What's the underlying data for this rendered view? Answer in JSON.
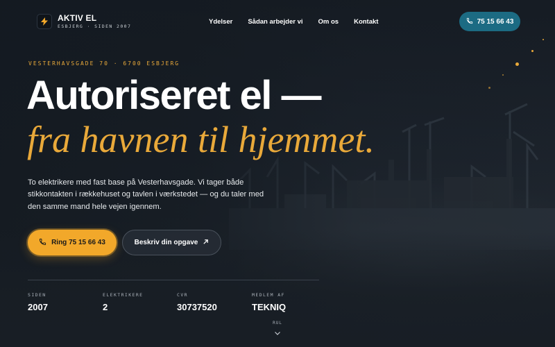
{
  "brand": {
    "name": "AKTIV EL",
    "subtitle": "ESBJERG · SIDEN 2007",
    "logo_icon": "lightning-bolt-icon"
  },
  "nav": {
    "links": [
      {
        "label": "Ydelser"
      },
      {
        "label": "Sådan arbejder vi"
      },
      {
        "label": "Om os"
      },
      {
        "label": "Kontakt"
      }
    ],
    "phone_label": "75 15 66 43",
    "phone_icon": "phone-icon"
  },
  "hero": {
    "address": "VESTERHAVSGADE 70 · 6700 ESBJERG",
    "headline": "Autoriseret el —",
    "headline_italic": "fra havnen til hjemmet.",
    "intro": "To elektrikere med fast base på Vesterhavsgade. Vi tager både stikkontakten i rækkehuset og tavlen i værkstedet — og du taler med den samme mand hele vejen igennem.",
    "primary_button": "Ring 75 15 66 43",
    "secondary_button": "Beskriv din opgave",
    "primary_icon": "phone-icon",
    "secondary_icon": "arrow-up-right-icon"
  },
  "stats": [
    {
      "label": "SIDEN",
      "value": "2007"
    },
    {
      "label": "ELEKTRIKERE",
      "value": "2"
    },
    {
      "label": "CVR",
      "value": "30737520"
    },
    {
      "label": "MEDLEM AF",
      "value": "TEKNIQ"
    }
  ],
  "scroll": {
    "label": "RUL",
    "icon": "chevron-down-icon"
  },
  "colors": {
    "accent": "#e9a93a",
    "button_primary": "#f2a82a",
    "nav_phone": "#1c6b83",
    "background": "#1b222b"
  }
}
